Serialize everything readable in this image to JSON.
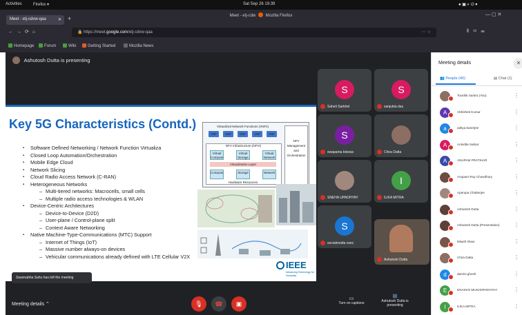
{
  "topbar": {
    "activities": "Activities",
    "app": "Firefox ▾",
    "clock": "Sat Sep 26 19:39",
    "window_title": "Meet - etj-cdw",
    "window_title_suffix": "Mozilla Firefox"
  },
  "browser": {
    "tab_title": "Meet - etj-cdvw-qaa",
    "url": "https://meet.google.com/etj-cdvw-qaa",
    "url_prefix": "https://meet.",
    "url_domain": "google.com",
    "url_path": "/etj-cdvw-qaa",
    "bookmarks": [
      "Homepage",
      "Forum",
      "Wiki",
      "Getting Started",
      "Mozilla News"
    ],
    "bookmark_colors": [
      "#4a9d3a",
      "#4a9d3a",
      "#4a9d3a",
      "#e05d2f",
      "#666666"
    ]
  },
  "presentation": {
    "banner": "Ashutosh Dutta is presenting",
    "slide_title": "Key 5G Characteristics (Contd.)",
    "bullets": [
      {
        "t": "Software Defined Networking / Network Function Virtualiza",
        "lvl": 0
      },
      {
        "t": "Closed Loop Automation/Orchestration",
        "lvl": 0
      },
      {
        "t": "Mobile Edge Cloud",
        "lvl": 0
      },
      {
        "t": "Network Slicing",
        "lvl": 0
      },
      {
        "t": "Cloud Radio Access Network (C-RAN)",
        "lvl": 0
      },
      {
        "t": "Heterogeneous Networks",
        "lvl": 0
      },
      {
        "t": "Multi-tiered networks:  Macrocells, small cells",
        "lvl": 1
      },
      {
        "t": "Multiple radio access technologies & WLAN",
        "lvl": 1
      },
      {
        "t": "Device-Centric Architectures",
        "lvl": 0
      },
      {
        "t": "Device-to-Device (D2D)",
        "lvl": 1
      },
      {
        "t": "User-plane / Control-plane split",
        "lvl": 1
      },
      {
        "t": "Context Aware Networking",
        "lvl": 1
      },
      {
        "t": "Native Machine-Type-Communications (MTC) Support",
        "lvl": 0
      },
      {
        "t": "Internet of Things (IoT)",
        "lvl": 1
      },
      {
        "t": "Massive number always-on devices",
        "lvl": 1
      },
      {
        "t": "Vehicular communications already defined with LTE Cellular V2X",
        "lvl": 1
      }
    ],
    "diagram": {
      "vnfs_title": "Virtualized Network Functions (VNFs)",
      "vnf": "VNF",
      "nfvi": "NFV Infrastructure (NFVI)",
      "vc": "Virtual Compute",
      "vs": "Virtual Storage",
      "vn": "Virtual Network",
      "vl": "Virtualization Layer",
      "compute": "Compute",
      "storage": "Storage",
      "network": "Network",
      "hw": "Hardware Resources",
      "mano": "NFV Management and Orchestration"
    },
    "ieee": {
      "name": "IEEE",
      "tagline": "Advancing Technology for Humanity"
    }
  },
  "participants_grid": [
    {
      "name": "Saheli Sarkhel",
      "initial": "S",
      "color": "#d81b60"
    },
    {
      "name": "sanjukta das",
      "initial": "S",
      "color": "#d81b60"
    },
    {
      "name": "swapama biswas",
      "initial": "S",
      "color": "#7b1fa2"
    },
    {
      "name": "Chira Datta",
      "initial": "",
      "color": "#8d6e63"
    },
    {
      "name": "SNEHA UPADHYAY",
      "initial": "",
      "color": "#a1887f"
    },
    {
      "name": "ILIKA MITRA",
      "initial": "I",
      "color": "#43a047"
    },
    {
      "name": "socialmedia nsec",
      "initial": "S",
      "color": "#1976d2"
    },
    {
      "name": "Ashutosh Dutta",
      "initial": "",
      "color": ""
    }
  ],
  "toast": "Swarnabha Sahu has left the meeting",
  "bottom": {
    "details": "Meeting details",
    "captions": "Turn on captions",
    "presenting": "Ashutosh Dutta is presenting"
  },
  "panel": {
    "title": "Meeting details",
    "people_tab": "People (40)",
    "chat_tab": "Chat (1)",
    "people": [
      {
        "name": "Toushik Santra (You)",
        "initial": "",
        "color": "#8d6e63"
      },
      {
        "name": "Abhishek Kumar",
        "initial": "A",
        "color": "#5e35b1"
      },
      {
        "name": "aditya banerjee",
        "initial": "a",
        "color": "#1e88e5"
      },
      {
        "name": "Anindita Sarkar",
        "initial": "A",
        "color": "#d81b60"
      },
      {
        "name": "ANUPAM PRATIHAR",
        "initial": "A",
        "color": "#3949ab"
      },
      {
        "name": "Anupam Roy Chowdhury",
        "initial": "",
        "color": "#6d4c41"
      },
      {
        "name": "Aparupa Chatterjee",
        "initial": "",
        "color": "#a1887f"
      },
      {
        "name": "Ashutosh Dutta",
        "initial": "",
        "color": "#5d4037"
      },
      {
        "name": "Ashutosh Dutta (Presentation)",
        "initial": "",
        "color": "#5d4037"
      },
      {
        "name": "bikash shaw",
        "initial": "",
        "color": "#795548"
      },
      {
        "name": "Chira Datta",
        "initial": "",
        "color": "#8d6e63"
      },
      {
        "name": "damini ghosh",
        "initial": "d",
        "color": "#1e88e5"
      },
      {
        "name": "ENAKKO MUKHOPADHYAY",
        "initial": "E",
        "color": "#43a047"
      },
      {
        "name": "ILIKA MITRA",
        "initial": "I",
        "color": "#43a047"
      }
    ]
  }
}
